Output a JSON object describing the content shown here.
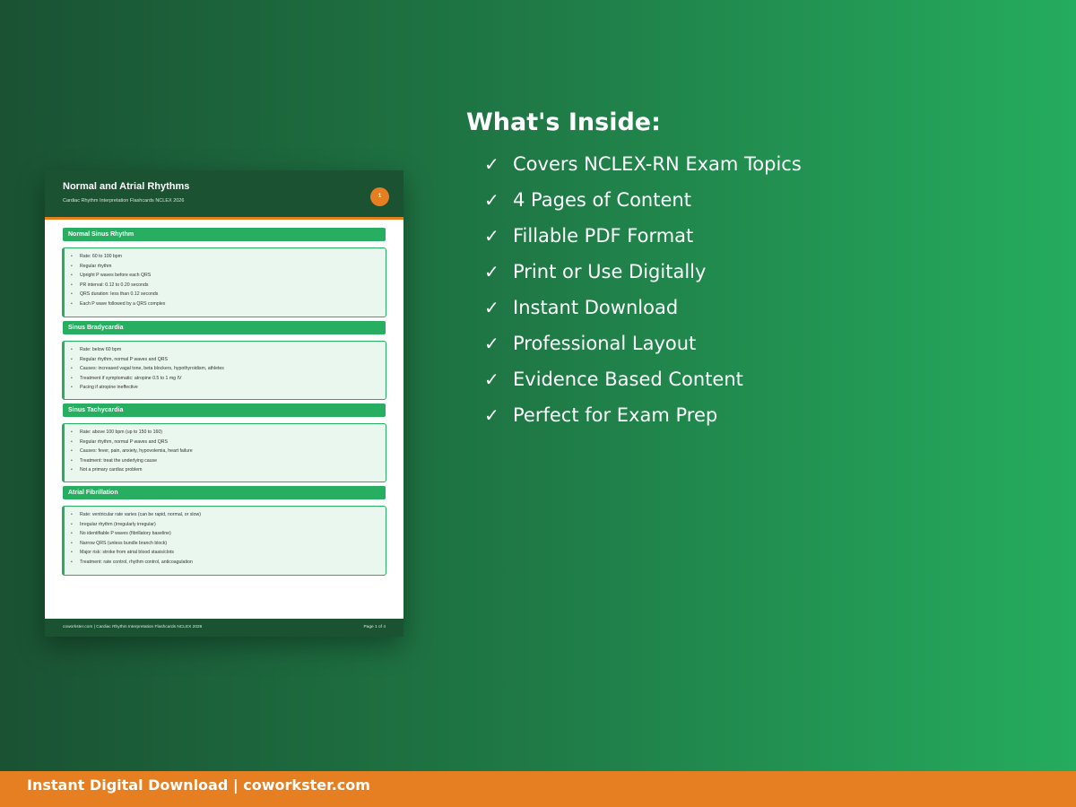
{
  "colors": {
    "brand_dark_green": "#1b5232",
    "brand_green": "#27ae60",
    "accent_orange": "#e67e22"
  },
  "document": {
    "title": "Normal and Atrial Rhythms",
    "subtitle": "Cardiac Rhythm Interpretation Flashcards NCLEX 2026",
    "page_badge": "1",
    "sections": [
      {
        "heading": "Normal Sinus Rhythm",
        "items": [
          "Rate: 60 to 100 bpm",
          "Regular rhythm",
          "Upright P waves before each QRS",
          "PR interval: 0.12 to 0.20 seconds",
          "QRS duration: less than 0.12 seconds",
          "Each P wave followed by a QRS complex"
        ]
      },
      {
        "heading": "Sinus Bradycardia",
        "items": [
          "Rate: below 60 bpm",
          "Regular rhythm, normal P waves and QRS",
          "Causes: increased vagal tone, beta blockers, hypothyroidism, athletes",
          "Treatment if symptomatic: atropine 0.5 to 1 mg IV",
          "Pacing if atropine ineffective"
        ]
      },
      {
        "heading": "Sinus Tachycardia",
        "items": [
          "Rate: above 100 bpm (up to 150 to 160)",
          "Regular rhythm, normal P waves and QRS",
          "Causes: fever, pain, anxiety, hypovolemia, heart failure",
          "Treatment: treat the underlying cause",
          "Not a primary cardiac problem"
        ]
      },
      {
        "heading": "Atrial Fibrillation",
        "items": [
          "Rate: ventricular rate varies (can be rapid, normal, or slow)",
          "Irregular rhythm (irregularly irregular)",
          "No identifiable P waves (fibrillatory baseline)",
          "Narrow QRS (unless bundle branch block)",
          "Major risk: stroke from atrial blood stasis/clots",
          "Treatment: rate control, rhythm control, anticoagulation"
        ]
      }
    ],
    "footer_left": "coworkster.com | Cardiac Rhythm Interpretation Flashcards NCLEX 2026",
    "footer_right": "Page 1 of 4"
  },
  "inside": {
    "title": "What's Inside:",
    "check_icon": "check-icon",
    "check_glyph": "✓",
    "features": [
      "Covers NCLEX-RN Exam Topics",
      "4 Pages of Content",
      "Fillable PDF Format",
      "Print or Use Digitally",
      "Instant Download",
      "Professional Layout",
      "Evidence Based Content",
      "Perfect for Exam Prep"
    ]
  },
  "banner": {
    "text": "Instant Digital Download | coworkster.com"
  }
}
